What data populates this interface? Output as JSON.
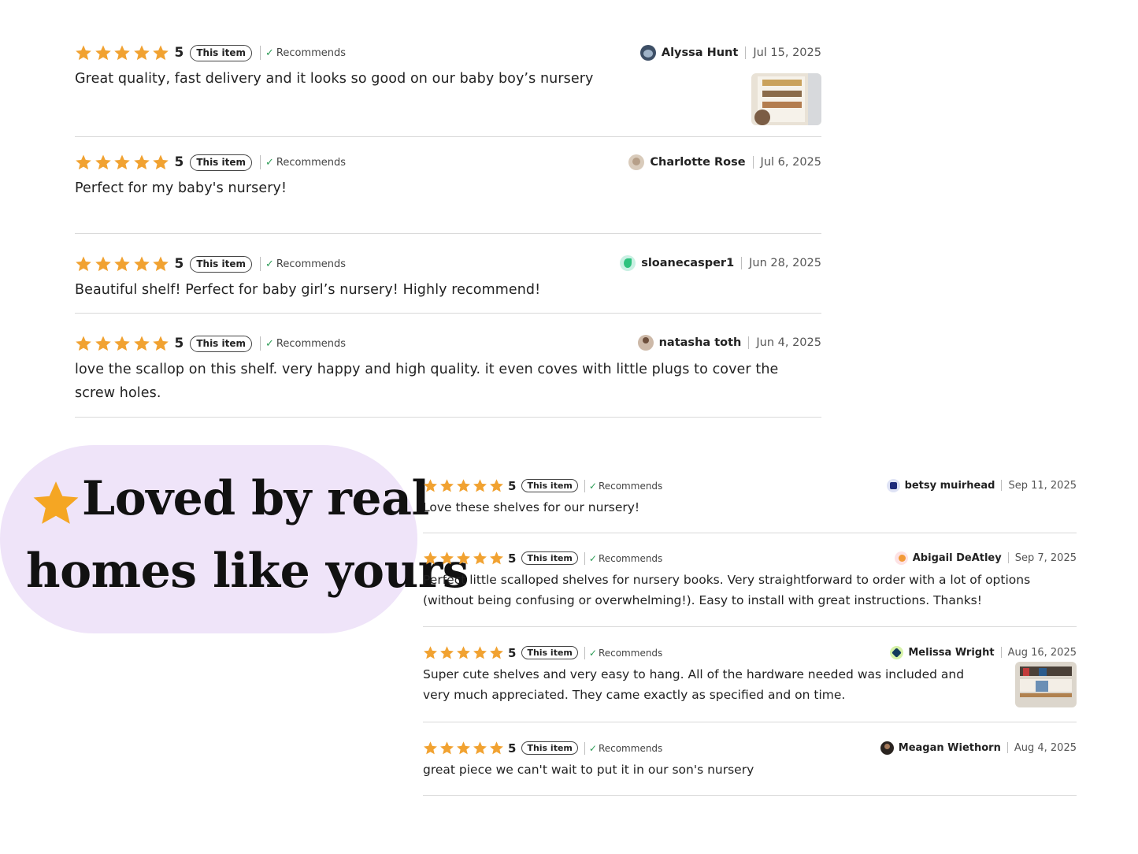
{
  "top_reviews": [
    {
      "rating": "5",
      "tag": "This item",
      "recommends": "Recommends",
      "author": "Alyssa Hunt",
      "date": "Jul 15, 2025",
      "text": "Great quality, fast delivery and it looks so good on our baby boy’s nursery"
    },
    {
      "rating": "5",
      "tag": "This item",
      "recommends": "Recommends",
      "author": "Charlotte Rose",
      "date": "Jul 6, 2025",
      "text": "Perfect for my baby's nursery!"
    },
    {
      "rating": "5",
      "tag": "This item",
      "recommends": "Recommends",
      "author": "sloanecasper1",
      "date": "Jun 28, 2025",
      "text": "Beautiful shelf! Perfect for baby girl’s nursery! Highly recommend!"
    },
    {
      "rating": "5",
      "tag": "This item",
      "recommends": "Recommends",
      "author": "natasha toth",
      "date": "Jun 4, 2025",
      "text": "love the scallop on this shelf. very happy and high quality. it even coves with little plugs to cover the screw holes."
    }
  ],
  "badge": {
    "line1": "Loved by real",
    "line2": "homes like yours"
  },
  "bottom_reviews": [
    {
      "rating": "5",
      "tag": "This item",
      "recommends": "Recommends",
      "author": "betsy muirhead",
      "date": "Sep 11, 2025",
      "text": "Love these shelves for our nursery!"
    },
    {
      "rating": "5",
      "tag": "This item",
      "recommends": "Recommends",
      "author": "Abigail DeAtley",
      "date": "Sep 7, 2025",
      "text": "Perfect little scalloped shelves for nursery books. Very straightforward to order with a lot of options (without being confusing or overwhelming!). Easy to install with great instructions. Thanks!"
    },
    {
      "rating": "5",
      "tag": "This item",
      "recommends": "Recommends",
      "author": "Melissa Wright",
      "date": "Aug 16, 2025",
      "text": "Super cute shelves and very easy to hang. All of the hardware needed was included and very much appreciated. They came exactly as specified and on time."
    },
    {
      "rating": "5",
      "tag": "This item",
      "recommends": "Recommends",
      "author": "Meagan Wiethorn",
      "date": "Aug 4, 2025",
      "text": "great piece we can't wait to put it in our son's nursery"
    }
  ],
  "colors": {
    "star": "#f1a231",
    "badge_bg": "#efe4f9",
    "check": "#2e9d57",
    "divider": "#d9d9d9"
  },
  "icons": {
    "star": "star-icon",
    "check": "checkmark-icon",
    "badge_star": "star-emoji-icon"
  }
}
